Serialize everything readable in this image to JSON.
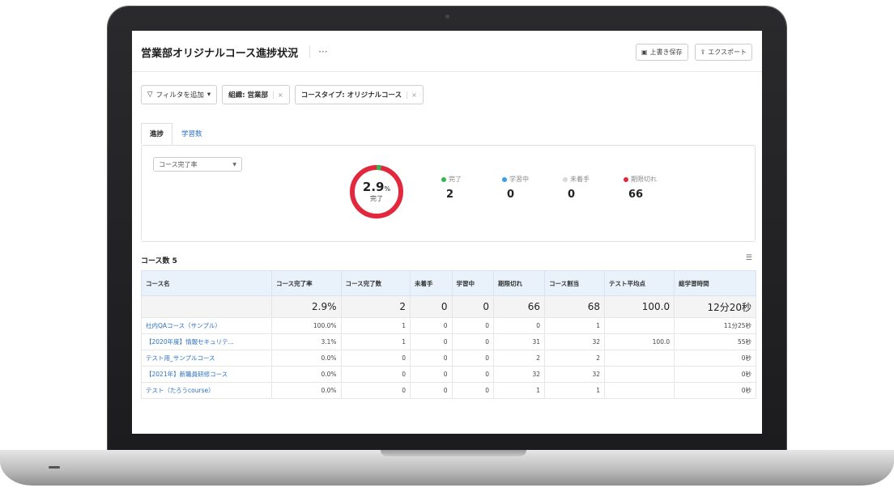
{
  "header": {
    "title": "営業部オリジナルコース進捗状況",
    "more": "···",
    "save_label": "上書き保存",
    "export_label": "エクスポート"
  },
  "filters": {
    "add_label": "フィルタを追加",
    "chips": [
      {
        "label": "組織: 営業部"
      },
      {
        "label": "コースタイプ: オリジナルコース"
      }
    ],
    "remove_glyph": "×"
  },
  "tabs": [
    {
      "label": "進捗",
      "active": true
    },
    {
      "label": "学習数",
      "active": false
    }
  ],
  "progress": {
    "metric_select": "コース完了率",
    "percent": "2.9",
    "percent_unit": "%",
    "sub_label": "完了",
    "legend": [
      {
        "label": "完了",
        "value": "2",
        "color": "#2eb84e"
      },
      {
        "label": "学習中",
        "value": "0",
        "color": "#3a9ee6"
      },
      {
        "label": "未着手",
        "value": "0",
        "color": "#d9d9d9"
      },
      {
        "label": "期限切れ",
        "value": "66",
        "color": "#e2283c"
      }
    ],
    "complete_fraction": 0.029
  },
  "table": {
    "count_label": "コース数 5",
    "headers": [
      "コース名",
      "コース完了率",
      "コース完了数",
      "未着手",
      "学習中",
      "期限切れ",
      "コース割当",
      "テスト平均点",
      "総学習時間"
    ],
    "summary": [
      "",
      "2.9%",
      "2",
      "0",
      "0",
      "66",
      "68",
      "100.0",
      "12分20秒"
    ],
    "rows": [
      [
        "社内QAコース（サンプル）",
        "100.0%",
        "1",
        "0",
        "0",
        "0",
        "1",
        "",
        "11分25秒"
      ],
      [
        "【2020年度】情報セキュリテ...",
        "3.1%",
        "1",
        "0",
        "0",
        "31",
        "32",
        "100.0",
        "55秒"
      ],
      [
        "テスト用_サンプルコース",
        "0.0%",
        "0",
        "0",
        "0",
        "2",
        "2",
        "",
        "0秒"
      ],
      [
        "【2021年】新職員研修コース",
        "0.0%",
        "0",
        "0",
        "0",
        "32",
        "32",
        "",
        "0秒"
      ],
      [
        "テスト（たろうcourse）",
        "0.0%",
        "0",
        "0",
        "0",
        "1",
        "1",
        "",
        "0秒"
      ]
    ]
  }
}
